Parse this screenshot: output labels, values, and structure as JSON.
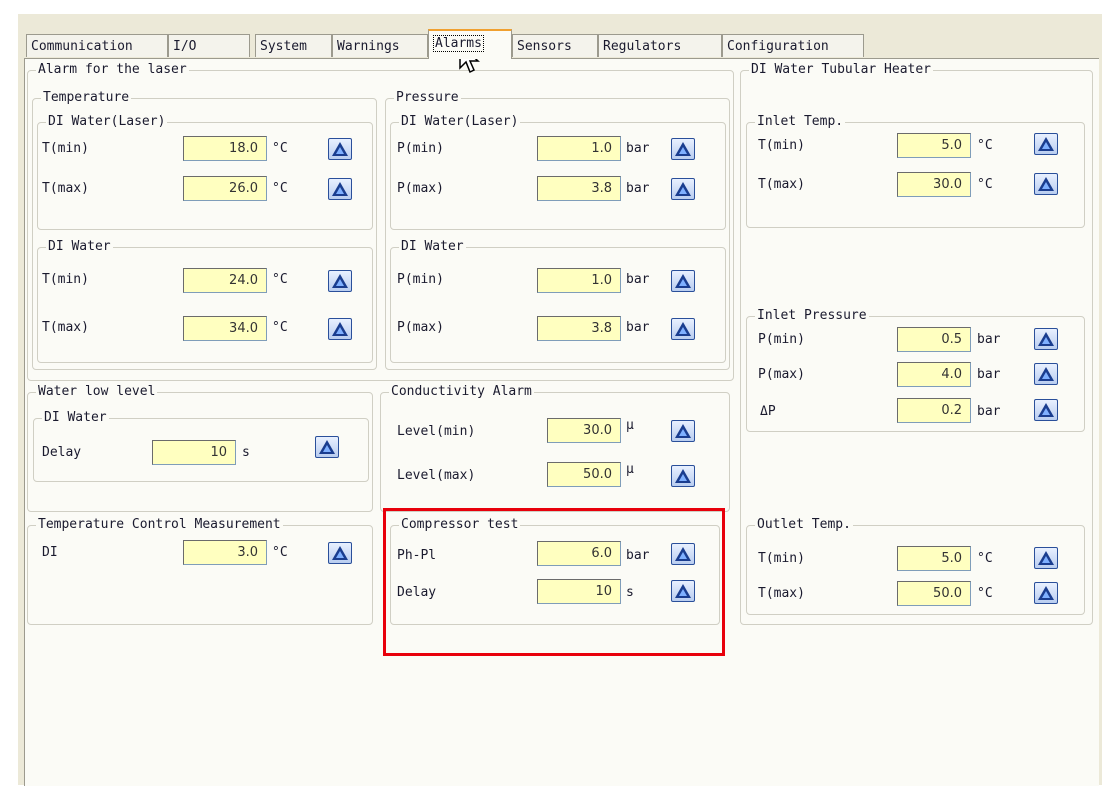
{
  "tabs": [
    "Communication",
    "I/O",
    "System",
    "Warnings",
    "Alarms",
    "Sensors",
    "Regulators",
    "Configuration"
  ],
  "active_tab": "Alarms",
  "laser": {
    "title": "Alarm for the laser",
    "temperature": {
      "title": "Temperature",
      "di_laser": {
        "title": "DI Water(Laser)",
        "tmin_label": "T(min)",
        "tmin": "18.0",
        "tmax_label": "T(max)",
        "tmax": "26.0",
        "unit": "°C"
      },
      "di_water": {
        "title": "DI Water",
        "tmin_label": "T(min)",
        "tmin": "24.0",
        "tmax_label": "T(max)",
        "tmax": "34.0",
        "unit": "°C"
      }
    },
    "pressure": {
      "title": "Pressure",
      "di_laser": {
        "title": "DI Water(Laser)",
        "pmin_label": "P(min)",
        "pmin": "1.0",
        "pmax_label": "P(max)",
        "pmax": "3.8",
        "unit": "bar"
      },
      "di_water": {
        "title": "DI Water",
        "pmin_label": "P(min)",
        "pmin": "1.0",
        "pmax_label": "P(max)",
        "pmax": "3.8",
        "unit": "bar"
      }
    }
  },
  "water_low": {
    "title": "Water low level",
    "sub_title": "DI Water",
    "delay_label": "Delay",
    "delay": "10",
    "unit": "s"
  },
  "conductivity": {
    "title": "Conductivity Alarm",
    "min_label": "Level(min)",
    "min": "30.0",
    "max_label": "Level(max)",
    "max": "50.0",
    "unit": "μ"
  },
  "temp_control": {
    "title": "Temperature Control Measurement",
    "di_label": "DI",
    "di": "3.0",
    "unit": "°C"
  },
  "compressor": {
    "title": "Compressor test",
    "php_label": "Ph-Pl",
    "php": "6.0",
    "php_unit": "bar",
    "delay_label": "Delay",
    "delay": "10",
    "delay_unit": "s"
  },
  "heater": {
    "title": "DI Water Tubular Heater",
    "inlet_temp": {
      "title": "Inlet Temp.",
      "tmin_label": "T(min)",
      "tmin": "5.0",
      "tmax_label": "T(max)",
      "tmax": "30.0",
      "unit": "°C"
    },
    "inlet_pressure": {
      "title": "Inlet Pressure",
      "pmin_label": "P(min)",
      "pmin": "0.5",
      "pmax_label": "P(max)",
      "pmax": "4.0",
      "dp_label": "ΔP",
      "dp": "0.2",
      "unit": "bar"
    },
    "outlet_temp": {
      "title": "Outlet Temp.",
      "tmin_label": "T(min)",
      "tmin": "5.0",
      "tmax_label": "T(max)",
      "tmax": "50.0",
      "unit": "°C"
    }
  },
  "colors": {
    "field_bg": "#ffffc0",
    "highlight": "#e8000b",
    "active_tab_accent": "#f0a030",
    "button_blue": "#2a4f9a"
  },
  "icons": {
    "alarm_button": "alarm-icon",
    "cursor": "mouse-pointer-icon"
  }
}
